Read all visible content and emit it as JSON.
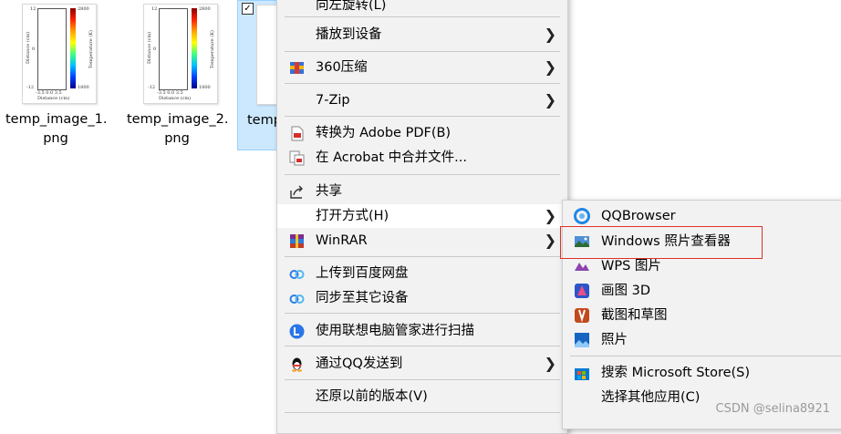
{
  "files": [
    {
      "name_line1": "temp_image_1.",
      "name_line2": "png"
    },
    {
      "name_line1": "temp_image_2.",
      "name_line2": "png"
    },
    {
      "name_line1": "temp"
    }
  ],
  "thumb_labels": {
    "y_top": "12",
    "y_bottom": "-12",
    "y_mid": "0",
    "x_ticks": "-3.5  0.0  3.5",
    "x_axis": "Distance (cm)",
    "y_axis": "Distance (cm)",
    "cbar_top": "2800",
    "cbar_bottom": "1800",
    "cbar_axis": "Temperature (K)"
  },
  "main_menu": {
    "rotate_left": "向左旋转(L)",
    "cast_to_device": "播放到设备",
    "compress_360": "360压缩",
    "seven_zip": "7-Zip",
    "convert_pdf": "转换为 Adobe PDF(B)",
    "acrobat_merge": "在 Acrobat 中合并文件...",
    "share": "共享",
    "open_with": "打开方式(H)",
    "winrar": "WinRAR",
    "upload_baidu": "上传到百度网盘",
    "sync_devices": "同步至其它设备",
    "lenovo_scan": "使用联想电脑管家进行扫描",
    "send_qq": "通过QQ发送到",
    "restore_versions": "还原以前的版本(V)"
  },
  "sub_menu": {
    "qqbrowser": "QQBrowser",
    "photo_viewer": "Windows 照片查看器",
    "wps_picture": "WPS 图片",
    "paint3d": "画图 3D",
    "snip_sketch": "截图和草图",
    "photos": "照片",
    "search_store": "搜索 Microsoft Store(S)",
    "choose_other": "选择其他应用(C)"
  },
  "watermark": "CSDN @selina8921",
  "colors": {
    "selection": "#cce8ff",
    "highlight_box": "#e0302a",
    "menu_bg": "#f2f2f2"
  }
}
